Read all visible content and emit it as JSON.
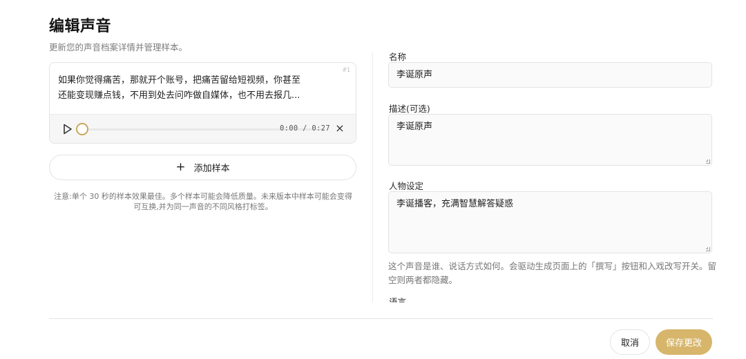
{
  "header": {
    "title": "编辑声音",
    "subtitle": "更新您的声音档案详情并管理样本。"
  },
  "sample": {
    "index": "#1",
    "text_line1": "如果你觉得痛苦，那就开个账号，把痛苦留给短视频，你甚至",
    "text_line2": "还能变现赚点钱，不用到处去问咋做自媒体，也不用去报几...",
    "time": "0:00 / 0:27",
    "play_icon": "play-icon",
    "close_icon": "close-icon",
    "progress": 0
  },
  "add_sample": {
    "plus": "+",
    "label": "添加样本"
  },
  "note": "注意:单个 30 秒的样本效果最佳。多个样本可能会降低质量。未来版本中样本可能会变得可互换,并为同一声音的不同风格打标签。",
  "form": {
    "name_label": "名称",
    "name_value": "李诞原声",
    "description_label": "描述(可选)",
    "description_value": "李诞原声",
    "persona_label": "人物设定",
    "persona_value": "李诞播客，充满智慧解答疑惑",
    "persona_hint": "这个声音是谁、说话方式如何。会驱动生成页面上的「撰写」按钮和入戏改写开关。留空则两者都隐藏。",
    "next_label": "语言"
  },
  "footer": {
    "cancel_label": "取消",
    "save_label": "保存更改"
  },
  "colors": {
    "accent": "#d7b66c",
    "thumb": "#c9a85c",
    "border": "#e3e3e3",
    "muted_text": "#777777"
  }
}
